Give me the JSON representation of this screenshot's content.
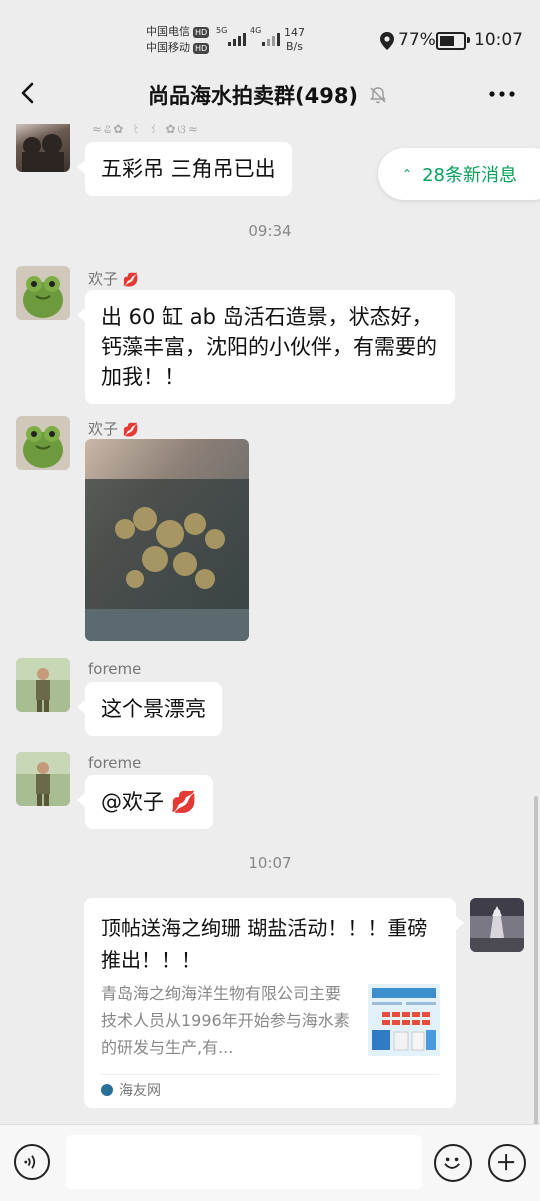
{
  "status": {
    "carrier1": "中国电信",
    "carrier2": "中国移动",
    "hd": "HD",
    "net1": "5G",
    "net2": "4G",
    "speed_value": "147",
    "speed_unit": "B/s",
    "battery": "77%",
    "battery_level": 0.77,
    "time": "10:07"
  },
  "header": {
    "title": "尚品海水拍卖群(498)"
  },
  "new_messages": "28条新消息",
  "timestamps": [
    "09:34",
    "10:07"
  ],
  "messages": [
    {
      "text": "五彩吊  三角吊已出"
    },
    {
      "sender": "欢子",
      "text": "出 60 缸 ab 岛活石造景，状态好，钙藻丰富，沈阳的小伙伴，有需要的加我！！"
    },
    {
      "sender": "欢子"
    },
    {
      "sender": "foreme",
      "text": "这个景漂亮"
    },
    {
      "sender": "foreme",
      "text": "@欢子"
    }
  ],
  "card": {
    "title": "顶帖送海之绚珊  瑚盐活动！！！重磅推出！！！",
    "desc": "青岛海之绚海洋生物有限公司主要技术人员从1996年开始参与海水素的研发与生产,有...",
    "source": "海友网"
  },
  "icons": {
    "back": "back-arrow-icon",
    "mute": "bell-muted-icon",
    "more": "more-icon",
    "voice": "voice-icon",
    "emoji": "emoji-icon",
    "plus": "plus-icon",
    "lips": "lips-emoji-icon",
    "location": "location-icon"
  },
  "colors": {
    "accent": "#07a15a",
    "background": "#ededed",
    "bubble": "#ffffff"
  }
}
